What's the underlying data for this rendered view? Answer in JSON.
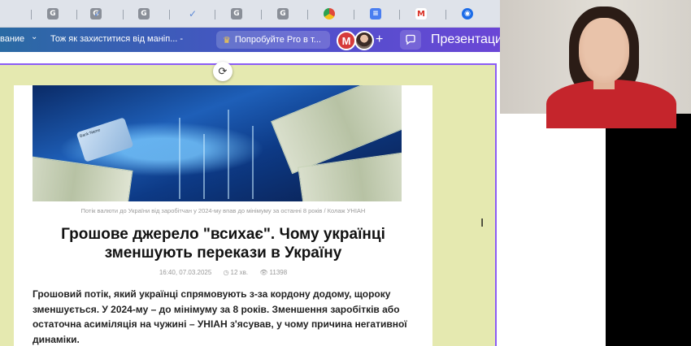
{
  "browser": {
    "bookmarks": [
      {
        "icon": "g-icon",
        "glyph": "G"
      },
      {
        "icon": "g-icon",
        "glyph": "G"
      },
      {
        "icon": "check-icon",
        "glyph": "✓"
      },
      {
        "icon": "g-icon",
        "glyph": "G"
      },
      {
        "icon": "check-icon",
        "glyph": "✓"
      },
      {
        "icon": "g-icon",
        "glyph": "G"
      },
      {
        "icon": "g-icon",
        "glyph": "G"
      },
      {
        "icon": "chrome-icon",
        "glyph": ""
      },
      {
        "icon": "docs-icon",
        "glyph": "≡"
      },
      {
        "icon": "gmail-icon",
        "glyph": "M"
      },
      {
        "icon": "meet-icon",
        "glyph": "◉"
      }
    ]
  },
  "toolbar": {
    "menu_label": "вание",
    "doc_title": "Тож як захиститися від маніп... -",
    "pro_label": "Попробуйте Pro в т...",
    "avatar_initial": "M",
    "present_label": "Презентации",
    "accent": "#6b46d6"
  },
  "article": {
    "caption": "Потік валюти до України від заробітчан у 2024-му впав до мінімуму за останні 8 років / Колаж УНІАН",
    "headline": "Грошове джерело \"всихає\". Чому українці зменшують перекази в Україну",
    "time": "16:40, 07.03.2025",
    "read_time": "12 хв.",
    "views": "11398",
    "lead": "Грошовий потік, який українці спрямовують з-за кордону додому, щороку зменшується. У 2024-му – до мінімуму за 8 років. Зменшення заробітків або остаточна асиміляція на чужині – УНІАН з'ясував, у чому причина негативної динаміки.",
    "hero_card_text": "Bank Name"
  },
  "colors": {
    "slide_bg": "#e5e9b0",
    "selection": "#8b5cf6",
    "avatar_red": "#d63b3b"
  }
}
